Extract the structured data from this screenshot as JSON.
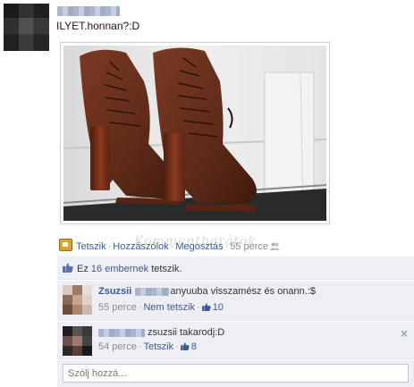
{
  "post": {
    "author_obscured": true,
    "text": "ILYET.honnan?:D",
    "photo_subject": "brown suede lace-up platform ankle boots"
  },
  "actions": {
    "like_label": "Tetszik",
    "comment_label": "Hozzászólok",
    "share_label": "Megosztás",
    "time": "55 perce"
  },
  "watermark": "Kommentbarátok",
  "likes": {
    "prefix": "Ez",
    "count_link": "16 embernek",
    "suffix": "tetszik."
  },
  "comments": [
    {
      "name": "Zsuzsii",
      "text": "anyuuba visszamész és onann.:$",
      "time": "55 perce",
      "unlike_label": "Nem tetszik",
      "likes": "10"
    },
    {
      "text": "zsuzsii takarodj:D",
      "time": "54 perce",
      "like_label": "Tetszik",
      "likes": "8",
      "close": "×"
    }
  ],
  "reply": {
    "placeholder": "Szólj hozzá..."
  },
  "colors": {
    "link": "#3b5998",
    "feedback_bg": "#edeff4",
    "meta": "#8a8a8a"
  }
}
